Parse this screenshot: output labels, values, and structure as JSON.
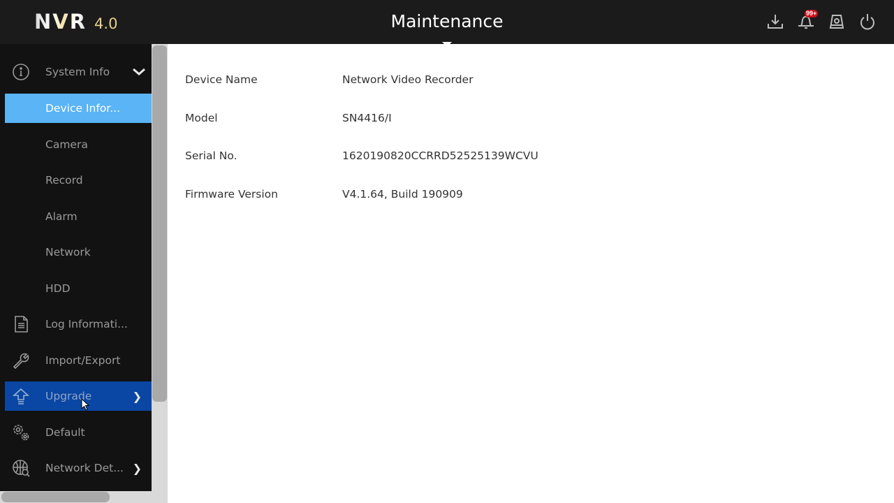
{
  "header": {
    "logo_main": "NVR",
    "logo_version": "4.0",
    "title": "Maintenance",
    "icons": [
      {
        "name": "download-icon"
      },
      {
        "name": "bell-icon",
        "badge": "99+"
      },
      {
        "name": "hdd-icon"
      },
      {
        "name": "power-icon"
      }
    ]
  },
  "sidebar": {
    "group": {
      "label": "System Info",
      "icon": "info-icon",
      "expanded": true
    },
    "sub_items": [
      {
        "label": "Device Infor...",
        "active": true
      },
      {
        "label": "Camera"
      },
      {
        "label": "Record"
      },
      {
        "label": "Alarm"
      },
      {
        "label": "Network"
      },
      {
        "label": "HDD"
      }
    ],
    "items": [
      {
        "label": "Log Informati...",
        "icon": "document-icon"
      },
      {
        "label": "Import/Export",
        "icon": "wrench-icon"
      },
      {
        "label": "Upgrade",
        "icon": "upgrade-arrow-icon",
        "has_submenu": true,
        "hovered": true
      },
      {
        "label": "Default",
        "icon": "gears-icon"
      },
      {
        "label": "Network Det...",
        "icon": "globe-search-icon",
        "has_submenu": true
      }
    ]
  },
  "device_info": [
    {
      "label": "Device Name",
      "value": "Network Video Recorder"
    },
    {
      "label": "Model",
      "value": "SN4416/I"
    },
    {
      "label": "Serial No.",
      "value": "1620190820CCRRD52525139WCVU"
    },
    {
      "label": "Firmware Version",
      "value": "V4.1.64, Build 190909"
    }
  ],
  "colors": {
    "topbar": "#1b1b1b",
    "sidebar": "#121212",
    "active_item": "#5ab4f5",
    "hover_item": "#0a46a3",
    "badge": "#c8101a"
  }
}
